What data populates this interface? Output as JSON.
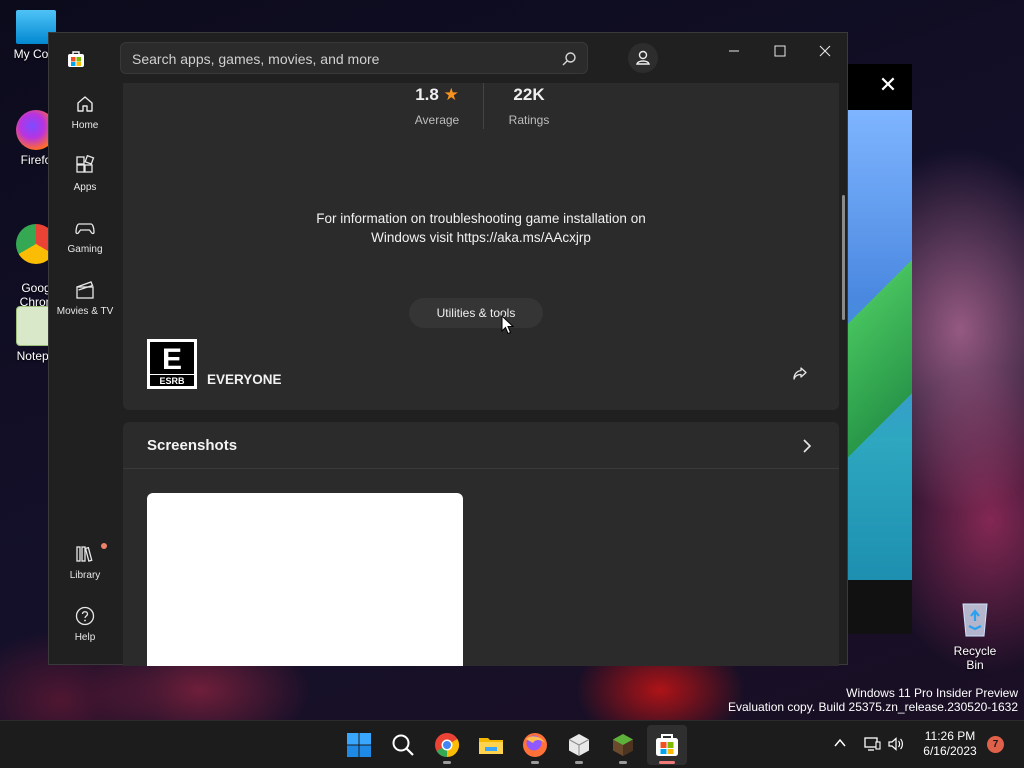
{
  "desktop": {
    "icons": [
      {
        "label": "My Com",
        "name": "This PC"
      },
      {
        "label": "Firefo",
        "name": "Firefox"
      },
      {
        "label": "Goog\nChron",
        "name": "Google Chrome"
      },
      {
        "label": "Notepa",
        "name": "Notepad++"
      }
    ],
    "recycle_bin": "Recycle Bin",
    "background_window_close": "✕"
  },
  "store": {
    "search": {
      "placeholder": "Search apps, games, movies, and more"
    },
    "nav": [
      {
        "label": "Home",
        "icon": "home-icon"
      },
      {
        "label": "Apps",
        "icon": "apps-icon"
      },
      {
        "label": "Gaming",
        "icon": "gamepad-icon"
      },
      {
        "label": "Movies & TV",
        "icon": "clapperboard-icon"
      },
      {
        "label": "Library",
        "icon": "library-icon"
      },
      {
        "label": "Help",
        "icon": "help-icon"
      }
    ],
    "rating": {
      "value": "1.8",
      "value_label": "Average",
      "count": "22K",
      "count_label": "Ratings"
    },
    "info_text": "For information on troubleshooting game installation on Windows visit https://aka.ms/AAcxjrp",
    "category_pill": "Utilities & tools",
    "esrb": {
      "letter": "E",
      "brand": "ESRB",
      "rating": "EVERYONE"
    },
    "screenshots": {
      "title": "Screenshots"
    }
  },
  "watermark": {
    "line1": "Windows 11 Pro Insider Preview",
    "line2": "Evaluation copy. Build 25375.zn_release.230520-1632"
  },
  "taskbar": {
    "apps": [
      "Start",
      "Search",
      "Google Chrome",
      "File Explorer",
      "Firefox",
      "App",
      "Minecraft",
      "Microsoft Store"
    ],
    "clock_time": "11:26 PM",
    "clock_date": "6/16/2023",
    "notifications": "7"
  },
  "colors": {
    "store_bg": "#202020",
    "card_bg": "#2b2b2b",
    "accent_star": "#f7921e",
    "notification": "#e0614a"
  }
}
